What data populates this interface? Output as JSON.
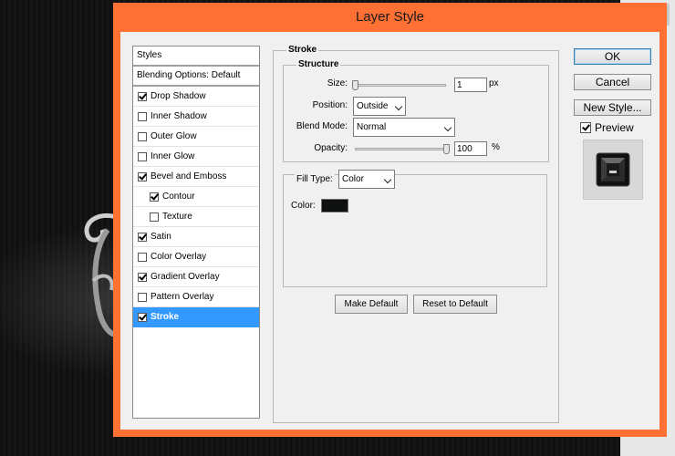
{
  "window": {
    "title": "Layer Style",
    "close_glyph": "✕"
  },
  "styles_panel": {
    "header": "Styles",
    "blending_options": "Blending Options: Default",
    "items": [
      {
        "label": "Drop Shadow",
        "checked": true
      },
      {
        "label": "Inner Shadow",
        "checked": false
      },
      {
        "label": "Outer Glow",
        "checked": false
      },
      {
        "label": "Inner Glow",
        "checked": false
      },
      {
        "label": "Bevel and Emboss",
        "checked": true
      },
      {
        "label": "Contour",
        "checked": true,
        "indent": true
      },
      {
        "label": "Texture",
        "checked": false,
        "indent": true
      },
      {
        "label": "Satin",
        "checked": true
      },
      {
        "label": "Color Overlay",
        "checked": false
      },
      {
        "label": "Gradient Overlay",
        "checked": true
      },
      {
        "label": "Pattern Overlay",
        "checked": false
      },
      {
        "label": "Stroke",
        "checked": true,
        "selected": true
      }
    ]
  },
  "stroke": {
    "title": "Stroke",
    "structure": {
      "title": "Structure",
      "size_label": "Size:",
      "size_value": "1",
      "size_unit": "px",
      "size_slider_fraction": 0.0,
      "position_label": "Position:",
      "position_value": "Outside",
      "blend_mode_label": "Blend Mode:",
      "blend_mode_value": "Normal",
      "opacity_label": "Opacity:",
      "opacity_value": "100",
      "opacity_unit": "%",
      "opacity_slider_fraction": 1.0
    },
    "fill": {
      "fill_type_label": "Fill Type:",
      "fill_type_value": "Color",
      "color_label": "Color:",
      "color_value": "#0f1010"
    },
    "make_default": "Make Default",
    "reset_default": "Reset to Default"
  },
  "actions": {
    "ok": "OK",
    "cancel": "Cancel",
    "new_style": "New Style...",
    "preview_label": "Preview",
    "preview_checked": true
  },
  "colors": {
    "titlebar": "#ff7034",
    "selection": "#3399ff",
    "client": "#f0f0f0"
  }
}
